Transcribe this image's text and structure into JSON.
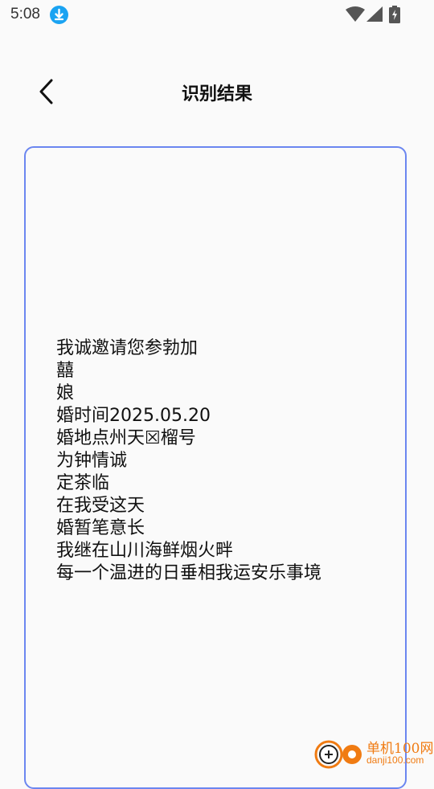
{
  "status_bar": {
    "time": "5:08",
    "icons": [
      "download-icon",
      "wifi-icon",
      "signal-icon",
      "battery-charging-icon"
    ]
  },
  "header": {
    "back_icon": "chevron-left-icon",
    "title": "识别结果"
  },
  "result": {
    "lines": [
      "我诚邀请您参勃加",
      "囍",
      "娘",
      "婚时间2025.05.20",
      "婚地点州天☒榴号",
      "为钟情诚",
      "定茶临",
      "在我受这天",
      "婚暂笔意长",
      "我继在山川海鲜烟火畔",
      "每一个温进的日垂相我运安乐事境"
    ]
  },
  "watermark": {
    "name": "单机100网",
    "url": "danji100.com"
  },
  "colors": {
    "card_border": "#6b86f0",
    "download_badge": "#1aa3f2",
    "watermark": "#f07b12"
  }
}
